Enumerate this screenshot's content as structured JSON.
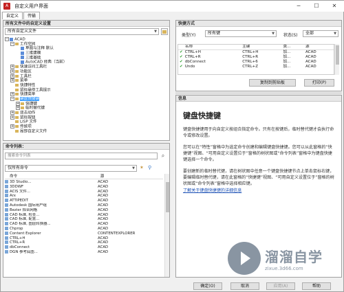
{
  "window": {
    "title": "自定义用户界面",
    "min_glyph": "─",
    "max_glyph": "☐",
    "close_glyph": "✕"
  },
  "tabs": [
    {
      "label": "自定义"
    },
    {
      "label": "传输"
    }
  ],
  "left_top": {
    "header": "所有文件中的自定义设置",
    "dropdown": "所有自定义文件",
    "tree": [
      {
        "label": "ACAD",
        "indent": 0,
        "exp": "−",
        "icon": "root"
      },
      {
        "label": "工作空间",
        "indent": 1,
        "exp": "−",
        "icon": "folder"
      },
      {
        "label": "草图与注释 默认",
        "indent": 2,
        "exp": "",
        "icon": "item"
      },
      {
        "label": "三维建模",
        "indent": 2,
        "exp": "",
        "icon": "item"
      },
      {
        "label": "三维基础",
        "indent": 2,
        "exp": "",
        "icon": "item"
      },
      {
        "label": "AutoCAD 经典（当前）",
        "indent": 2,
        "exp": "",
        "icon": "item"
      },
      {
        "label": "快速访问工具栏",
        "indent": 1,
        "exp": "+",
        "icon": "folder"
      },
      {
        "label": "功能区",
        "indent": 1,
        "exp": "+",
        "icon": "folder"
      },
      {
        "label": "工具栏",
        "indent": 1,
        "exp": "+",
        "icon": "folder"
      },
      {
        "label": "菜单",
        "indent": 1,
        "exp": "+",
        "icon": "folder"
      },
      {
        "label": "快捷特性",
        "indent": 1,
        "exp": "",
        "icon": "folder"
      },
      {
        "label": "鼠标悬停工具提示",
        "indent": 1,
        "exp": "",
        "icon": "folder"
      },
      {
        "label": "快捷菜单",
        "indent": 1,
        "exp": "+",
        "icon": "folder"
      },
      {
        "label": "键盘快捷键",
        "indent": 1,
        "exp": "−",
        "icon": "folder",
        "highlight": true
      },
      {
        "label": "快捷键",
        "indent": 2,
        "exp": "+",
        "icon": "folder"
      },
      {
        "label": "临时替代键",
        "indent": 2,
        "exp": "+",
        "icon": "folder"
      },
      {
        "label": "双击动作",
        "indent": 1,
        "exp": "+",
        "icon": "folder"
      },
      {
        "label": "鼠标按钮",
        "indent": 1,
        "exp": "+",
        "icon": "folder"
      },
      {
        "label": "LISP 文件",
        "indent": 1,
        "exp": "",
        "icon": "folder"
      },
      {
        "label": "传统项",
        "indent": 1,
        "exp": "+",
        "icon": "folder"
      },
      {
        "label": "局部自定义文件",
        "indent": 1,
        "exp": "",
        "icon": "folder"
      }
    ]
  },
  "left_bottom": {
    "header": "命令列表：",
    "search_placeholder": "搜索命令列表",
    "filter": "仅所有命令",
    "col_command": "命令",
    "col_source": "源",
    "commands": [
      {
        "name": "3D Studio...",
        "source": "ACAD"
      },
      {
        "name": "3DDWF",
        "source": "ACAD"
      },
      {
        "name": "ACIS 文件...",
        "source": "ACAD"
      },
      {
        "name": "Arx",
        "source": "ACAD"
      },
      {
        "name": "ATTIPEDIT",
        "source": "ACAD"
      },
      {
        "name": "Autodesk 国际用户组",
        "source": "ACAD"
      },
      {
        "name": "Bezier 拟合网格",
        "source": "ACAD"
      },
      {
        "name": "CAD 标准, 检查...",
        "source": "ACAD"
      },
      {
        "name": "CAD 标准, 配置...",
        "source": "ACAD"
      },
      {
        "name": "CAD 标准, 图层转换器...",
        "source": "ACAD"
      },
      {
        "name": "Chprop",
        "source": "ACAD"
      },
      {
        "name": "Content Explorer",
        "source": "CONTENTEXPLORER"
      },
      {
        "name": "CTRL+H",
        "source": "ACAD"
      },
      {
        "name": "CTRL+R",
        "source": "ACAD"
      },
      {
        "name": "dbConnect",
        "source": "ACAD"
      },
      {
        "name": "DGN 参考底图...",
        "source": "ACAD"
      }
    ]
  },
  "right_top": {
    "header": "快捷方式",
    "type_label": "类型(Y)",
    "type_value": "所有键",
    "status_label": "状态(S)",
    "status_value": "全部",
    "col_name": "名称",
    "col_key": "主键",
    "col_type": "类...",
    "col_source": "源",
    "rows": [
      {
        "name": "CTRL+H",
        "key": "CTRL+H",
        "type": "加...",
        "source": "ACAD"
      },
      {
        "name": "CTRL+R",
        "key": "CTRL+R",
        "type": "加...",
        "source": "ACAD"
      },
      {
        "name": "dbConnect",
        "key": "CTRL+6",
        "type": "加...",
        "source": "ACAD"
      },
      {
        "name": "Undo",
        "key": "CTRL+Z",
        "type": "加...",
        "source": "ACAD"
      }
    ],
    "copy_button": "复制到剪贴板",
    "print_button": "打印(P)"
  },
  "right_info": {
    "header": "信息",
    "title": "键盘快捷键",
    "p1": "键盘快捷键用于向自定义按组合指定命令。只有在按键后，临时替代键才会执行命令或修改设置。",
    "p2": "您可以在“特性”窗格中为选定命令创建和编辑键盘快捷键。您可以从此窗格的“快捷键”视图、“可用自定义设置位于”窗格的树状图或“命令列表”窗格中为键盘快捷键选择一个命令。",
    "p3": "要创建新的临时替代键，请在树状图中任意一个键盘快捷键节点上单击鼠标右键，要编辑临时替代键，请在此窗格的“快捷键”视图、“可用自定义设置位于”窗格的树状图或“命令列表”窗格中选择相应键。",
    "link": "了解关于键盘快捷键的详细信息"
  },
  "footer": {
    "ok": "确定(O)",
    "cancel": "取消",
    "apply": "应用(A)",
    "help": "帮助"
  },
  "watermark": {
    "main": "溜溜自学",
    "sub": "zixue.3d66.com"
  }
}
